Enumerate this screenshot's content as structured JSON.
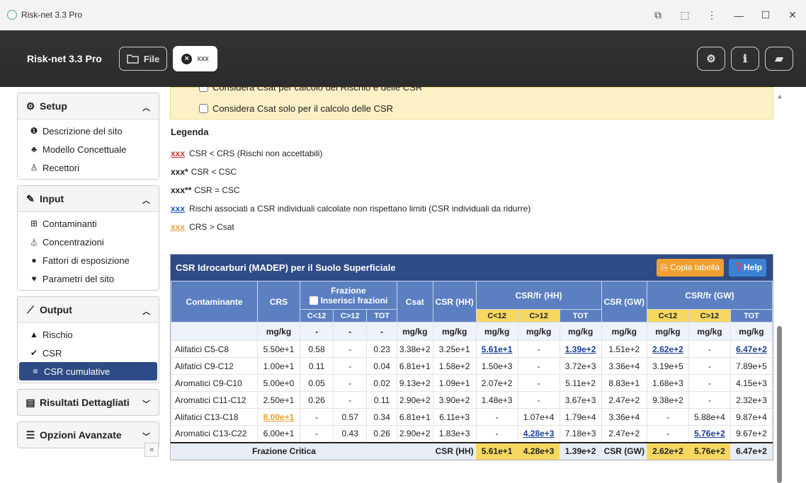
{
  "window": {
    "title": "Risk-net 3.3 Pro"
  },
  "topbar": {
    "brand": "Risk-net 3.3 Pro",
    "file_label": "File",
    "tab_label": "xxx"
  },
  "sidebar": {
    "setup": {
      "title": "Setup",
      "items": [
        "Descrizione del sito",
        "Modello Concettuale",
        "Recettori"
      ]
    },
    "input": {
      "title": "Input",
      "items": [
        "Contaminanti",
        "Concentrazioni",
        "Fattori di esposizione",
        "Parametri del sito"
      ]
    },
    "output": {
      "title": "Output",
      "items": [
        "Rischio",
        "CSR",
        "CSR cumulative"
      ]
    },
    "risultati": {
      "title": "Risultati Dettagliati"
    },
    "opzioni": {
      "title": "Opzioni Avanzate"
    },
    "collapse": "«"
  },
  "options": {
    "cut_text": "Considera Csat per calcolo del Rischio e delle CSR",
    "csat_only": "Considera Csat solo per il calcolo delle CSR"
  },
  "legend": {
    "title": "Legenda",
    "rows": [
      {
        "tag": "xxx",
        "text": "CSR < CRS (Rischi non accettabili)"
      },
      {
        "tag": "xxx*",
        "text": "CSR < CSC"
      },
      {
        "tag": "xxx**",
        "text": "CSR = CSC"
      },
      {
        "tag": "xxx",
        "text": "Rischi associati a CSR individuali calcolate non rispettano limiti (CSR individuali da ridurre)"
      },
      {
        "tag": "xxx",
        "text": "CRS > Csat"
      }
    ]
  },
  "table": {
    "title": "CSR Idrocarburi (MADEP) per il Suolo Superficiale",
    "copy_label": "Copia tabella",
    "help_label": "Help",
    "headers": {
      "contaminante": "Contaminante",
      "crs": "CRS",
      "frazione": "Frazione",
      "inserisci": "Inserisci frazioni",
      "csat": "Csat",
      "csr_hh": "CSR (HH)",
      "csrfr_hh": "CSR/fr (HH)",
      "csr_gw": "CSR (GW)",
      "csrfr_gw": "CSR/fr (GW)",
      "c_lt12": "C<12",
      "c_gt12": "C>12",
      "tot": "TOT"
    },
    "units": [
      "mg/kg",
      "-",
      "-",
      "-",
      "mg/kg",
      "mg/kg",
      "mg/kg",
      "mg/kg",
      "mg/kg",
      "mg/kg",
      "mg/kg",
      "mg/kg",
      "mg/kg"
    ],
    "rows": [
      [
        "Alifatici C5-C8",
        "5.50e+1",
        "0.58",
        "-",
        "0.23",
        "3.38e+2",
        "3.25e+1",
        "5.61e+1",
        "-",
        "1.39e+2",
        "1.51e+2",
        "2.62e+2",
        "-",
        "6.47e+2"
      ],
      [
        "Alifatici C9-C12",
        "1.00e+1",
        "0.11",
        "-",
        "0.04",
        "6.81e+1",
        "1.58e+2",
        "1.50e+3",
        "-",
        "3.72e+3",
        "3.36e+4",
        "3.19e+5",
        "-",
        "7.89e+5"
      ],
      [
        "Aromatici C9-C10",
        "5.00e+0",
        "0.05",
        "-",
        "0.02",
        "9.13e+2",
        "1.09e+1",
        "2.07e+2",
        "-",
        "5.11e+2",
        "8.83e+1",
        "1.68e+3",
        "-",
        "4.15e+3"
      ],
      [
        "Aromatici C11-C12",
        "2.50e+1",
        "0.26",
        "-",
        "0.11",
        "2.90e+2",
        "3.90e+2",
        "1.48e+3",
        "-",
        "3.67e+3",
        "2.47e+2",
        "9.38e+2",
        "-",
        "2.32e+3"
      ],
      [
        "Alifatici C13-C18",
        "8.00e+1",
        "-",
        "0.57",
        "0.34",
        "6.81e+1",
        "6.11e+3",
        "-",
        "1.07e+4",
        "1.79e+4",
        "3.36e+4",
        "-",
        "5.88e+4",
        "9.87e+4"
      ],
      [
        "Aromatici C13-C22",
        "6.00e+1",
        "-",
        "0.43",
        "0.26",
        "2.90e+2",
        "1.83e+3",
        "-",
        "4.28e+3",
        "7.18e+3",
        "2.47e+2",
        "-",
        "5.76e+2",
        "9.67e+2"
      ]
    ],
    "footer": {
      "label": "Frazione Critica",
      "hh": "CSR (HH)",
      "hh_vals": [
        "5.61e+1",
        "4.28e+3",
        "1.39e+2"
      ],
      "gw": "CSR (GW)",
      "gw_vals": [
        "2.62e+2",
        "5.76e+2",
        "6.47e+2"
      ]
    }
  }
}
